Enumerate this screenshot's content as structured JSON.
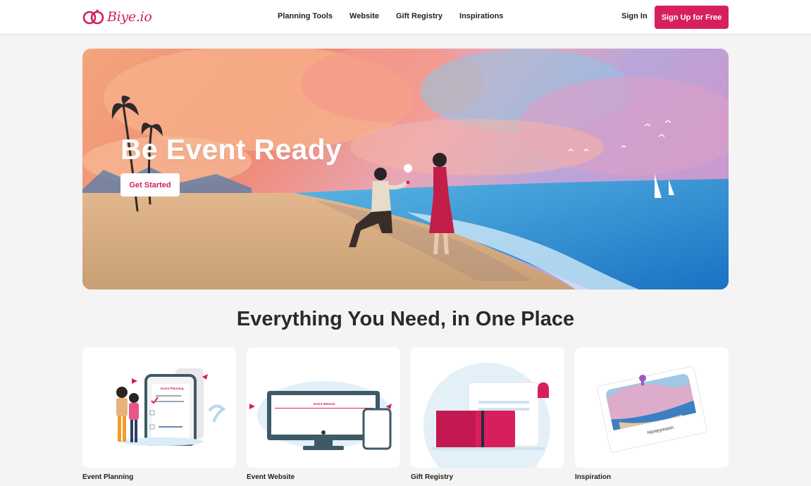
{
  "brand": {
    "name": "Biye.io",
    "color": "#d61f5c"
  },
  "nav": {
    "items": [
      {
        "label": "Planning Tools"
      },
      {
        "label": "Website"
      },
      {
        "label": "Gift Registry"
      },
      {
        "label": "Inspirations"
      }
    ],
    "signin_label": "Sign In",
    "signup_label": "Sign Up for Free"
  },
  "hero": {
    "title": "Be Event Ready",
    "cta_label": "Get Started"
  },
  "features": {
    "title": "Everything You Need, in One Place",
    "cards": [
      {
        "label": "Event Planning",
        "illustration_text": "Event Planning"
      },
      {
        "label": "Event Website",
        "illustration_text": "Event Website"
      },
      {
        "label": "Gift Registry"
      },
      {
        "label": "Inspiration",
        "illustration_text": "Honeymoon"
      }
    ]
  }
}
